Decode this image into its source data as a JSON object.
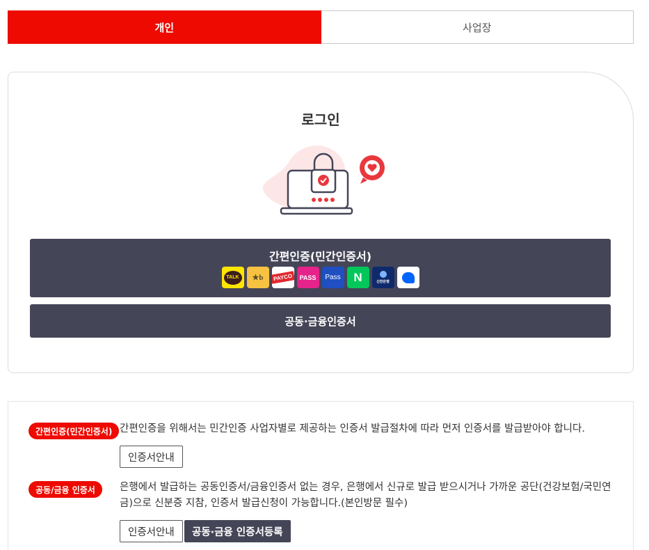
{
  "tabs": [
    {
      "label": "개인",
      "active": true
    },
    {
      "label": "사업장",
      "active": false
    }
  ],
  "login": {
    "title": "로그인",
    "illustration": "laptop-lock-icon",
    "simple_auth_label": "간편인증(민간인증서)",
    "providers": [
      {
        "name": "kakao",
        "text": "TALK",
        "bg": "#fee500",
        "fg": "#3c1e1e"
      },
      {
        "name": "kb",
        "text": "★b",
        "bg": "#f7c242",
        "fg": "#5a4a2a"
      },
      {
        "name": "payco",
        "text": "PAYCO",
        "bg": "#ffffff",
        "fg": "#e3262e"
      },
      {
        "name": "pass",
        "text": "PASS",
        "bg": "#e5238b",
        "fg": "#ffffff"
      },
      {
        "name": "samsung-pass",
        "text": "Pass",
        "bg": "#1f4fc1",
        "fg": "#ffffff"
      },
      {
        "name": "naver",
        "text": "N",
        "bg": "#03c75a",
        "fg": "#ffffff"
      },
      {
        "name": "shinhan",
        "text": "신한은행",
        "bg": "#0f2a6b",
        "fg": "#ffffff"
      },
      {
        "name": "toss",
        "text": "",
        "bg": "#ffffff",
        "fg": "#0064ff"
      }
    ],
    "public_cert_label": "공동·금융인증서"
  },
  "info": {
    "simple": {
      "badge": "간편인증(민간인증서)",
      "text": "간편인증을 위해서는 민간인증 사업자별로 제공하는 인증서 발급절차에 따라 먼저 인증서를 발급받아야 합니다.",
      "guide_button": "인증서안내"
    },
    "public": {
      "badge": "공동/금융 인증서",
      "text": "은행에서 발급하는 공동인증서/금융인증서 없는 경우, 은행에서 신규로 발급 받으시거나 가까운 공단(건강보험/국민연금)으로 신분증 지참, 인증서 발급신청이 가능합니다.(본인방문 필수)",
      "guide_button": "인증서안내",
      "register_button": "공동·금융 인증서등록"
    }
  },
  "colors": {
    "accent": "#ee0a00",
    "dark_button": "#454558"
  }
}
